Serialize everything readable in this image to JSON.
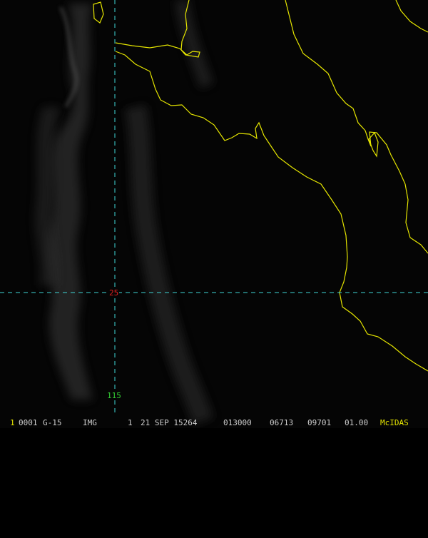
{
  "grid": {
    "latitude_label": "25",
    "longitude_label": "115"
  },
  "status": {
    "frame": "1",
    "sequence": "0001",
    "satellite": "G-15",
    "type": "IMG",
    "band": "1",
    "date": "21 SEP 15264",
    "time": "013000",
    "line": "06713",
    "element": "09701",
    "resolution": "01.00",
    "software": "McIDAS"
  },
  "colors": {
    "coastline": "#e6e600",
    "grid_line": "#3fd6d6",
    "latitude_label": "#e02020",
    "longitude_label": "#33cc33",
    "software_label": "#e6e600",
    "frame_label": "#e6e600",
    "status_text": "#cfcfcf"
  }
}
